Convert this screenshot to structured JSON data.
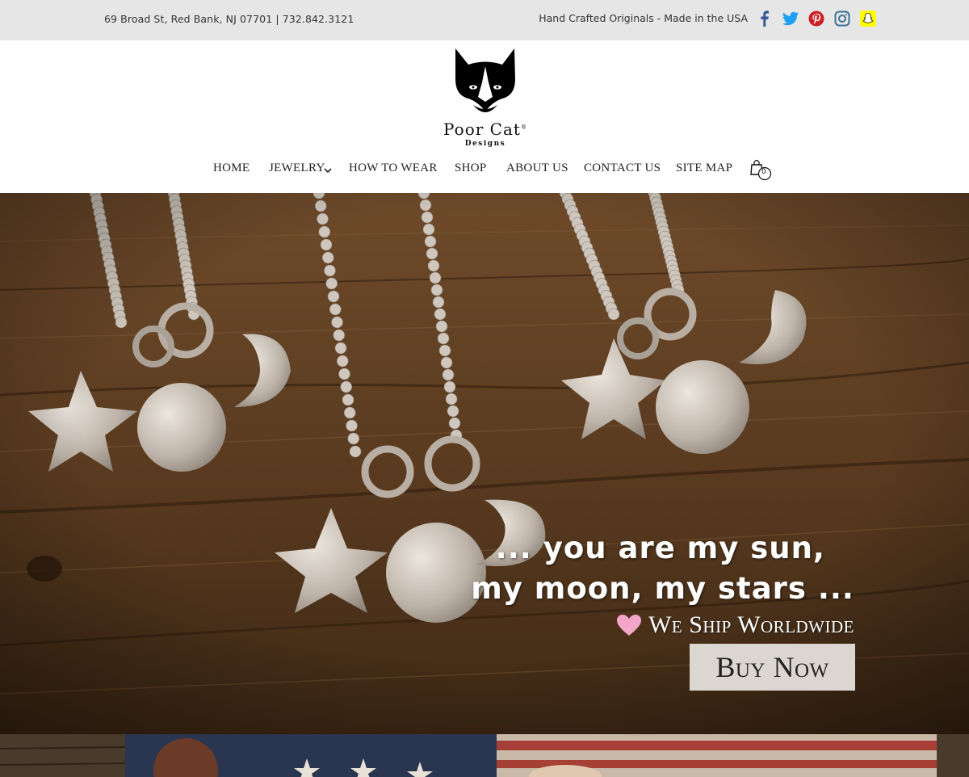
{
  "topbar": {
    "address": "69 Broad St, Red Bank, NJ 07701 | 732.842.3121",
    "tagline": "Hand Crafted Originals - Made in the USA",
    "social": [
      {
        "icon": "facebook-icon",
        "color": "#3b5998"
      },
      {
        "icon": "twitter-icon",
        "color": "#1da1f2"
      },
      {
        "icon": "pinterest-icon",
        "color": "#cb2027"
      },
      {
        "icon": "instagram-icon",
        "color": "#3f729b"
      },
      {
        "icon": "snapchat-icon",
        "color": "#fffc00"
      }
    ]
  },
  "brand": {
    "name": "Poor Cat",
    "sub": "Designs",
    "mark": "®"
  },
  "nav": {
    "home": "HOME",
    "jewelry": "JEWELRY",
    "how_to_wear": "HOW TO WEAR",
    "shop": "SHOP",
    "about": "ABOUT US",
    "contact": "CONTACT US",
    "sitemap": "SITE MAP",
    "cart_count": "0"
  },
  "hero": {
    "quote_line1": "... you are my sun,",
    "quote_line2": "my moon, my stars ...",
    "ship_text": "We Ship Worldwide",
    "button": "Buy Now",
    "heart_color": "#f4a6c8"
  }
}
